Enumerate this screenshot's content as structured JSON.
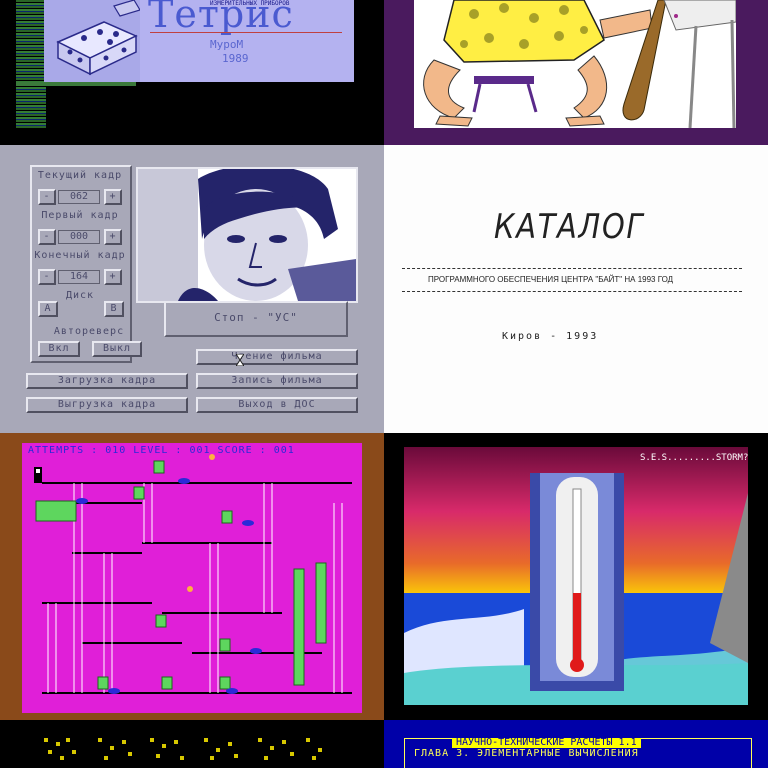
{
  "tetris": {
    "title": "Тетрис",
    "institute": "ИЗМЕРИТЕЛЬНЫХ ПРИБОРОВ",
    "city": "МуроМ",
    "year": "1989"
  },
  "film_editor": {
    "current_frame_label": "Текущий кадр",
    "current_frame_value": "062",
    "first_frame_label": "Первый кадр",
    "first_frame_value": "000",
    "last_frame_label": "Конечный кадр",
    "last_frame_value": "164",
    "minus": "-",
    "plus": "+",
    "disk_label": "Диск",
    "disk_a": "A",
    "disk_b": "B",
    "autoreverse_label": "Автореверс",
    "on_label": "Вкл",
    "off_label": "Выкл",
    "status_text": "Стоп - \"УС\"",
    "read_film": "Чтение фильма",
    "load_frame": "Загрузка кадра",
    "write_film": "Запись фильма",
    "unload_frame": "Выгрузка кадра",
    "exit_dos": "Выход в ДОС"
  },
  "catalog": {
    "title": "КАТАЛОГ",
    "subtitle": "ПРОГРАММНОГО ОБЕСПЕЧЕНИЯ  ЦЕНТРА \"БАЙТ\" НА 1993 ГОД",
    "footer": "Киров - 1993"
  },
  "game": {
    "hud": "ATTEMPTS : 010   LEVEL : 001   SCORE : 001"
  },
  "storm": {
    "brand": "S.E.S.........STORM?"
  },
  "science": {
    "header": "НАУЧНО-ТЕХНИЧЕСКИЕ РАСЧЕТЫ 1.1",
    "chapter": "ГЛАВА 3.  ЭЛЕМЕНТАРНЫЕ ВЫЧИСЛЕНИЯ"
  },
  "colors": {
    "tetris_panel": "#b4b2f0",
    "editor_bg": "#a8a8b8",
    "game_field": "#e01fd8",
    "science_bg": "#0000a8"
  }
}
